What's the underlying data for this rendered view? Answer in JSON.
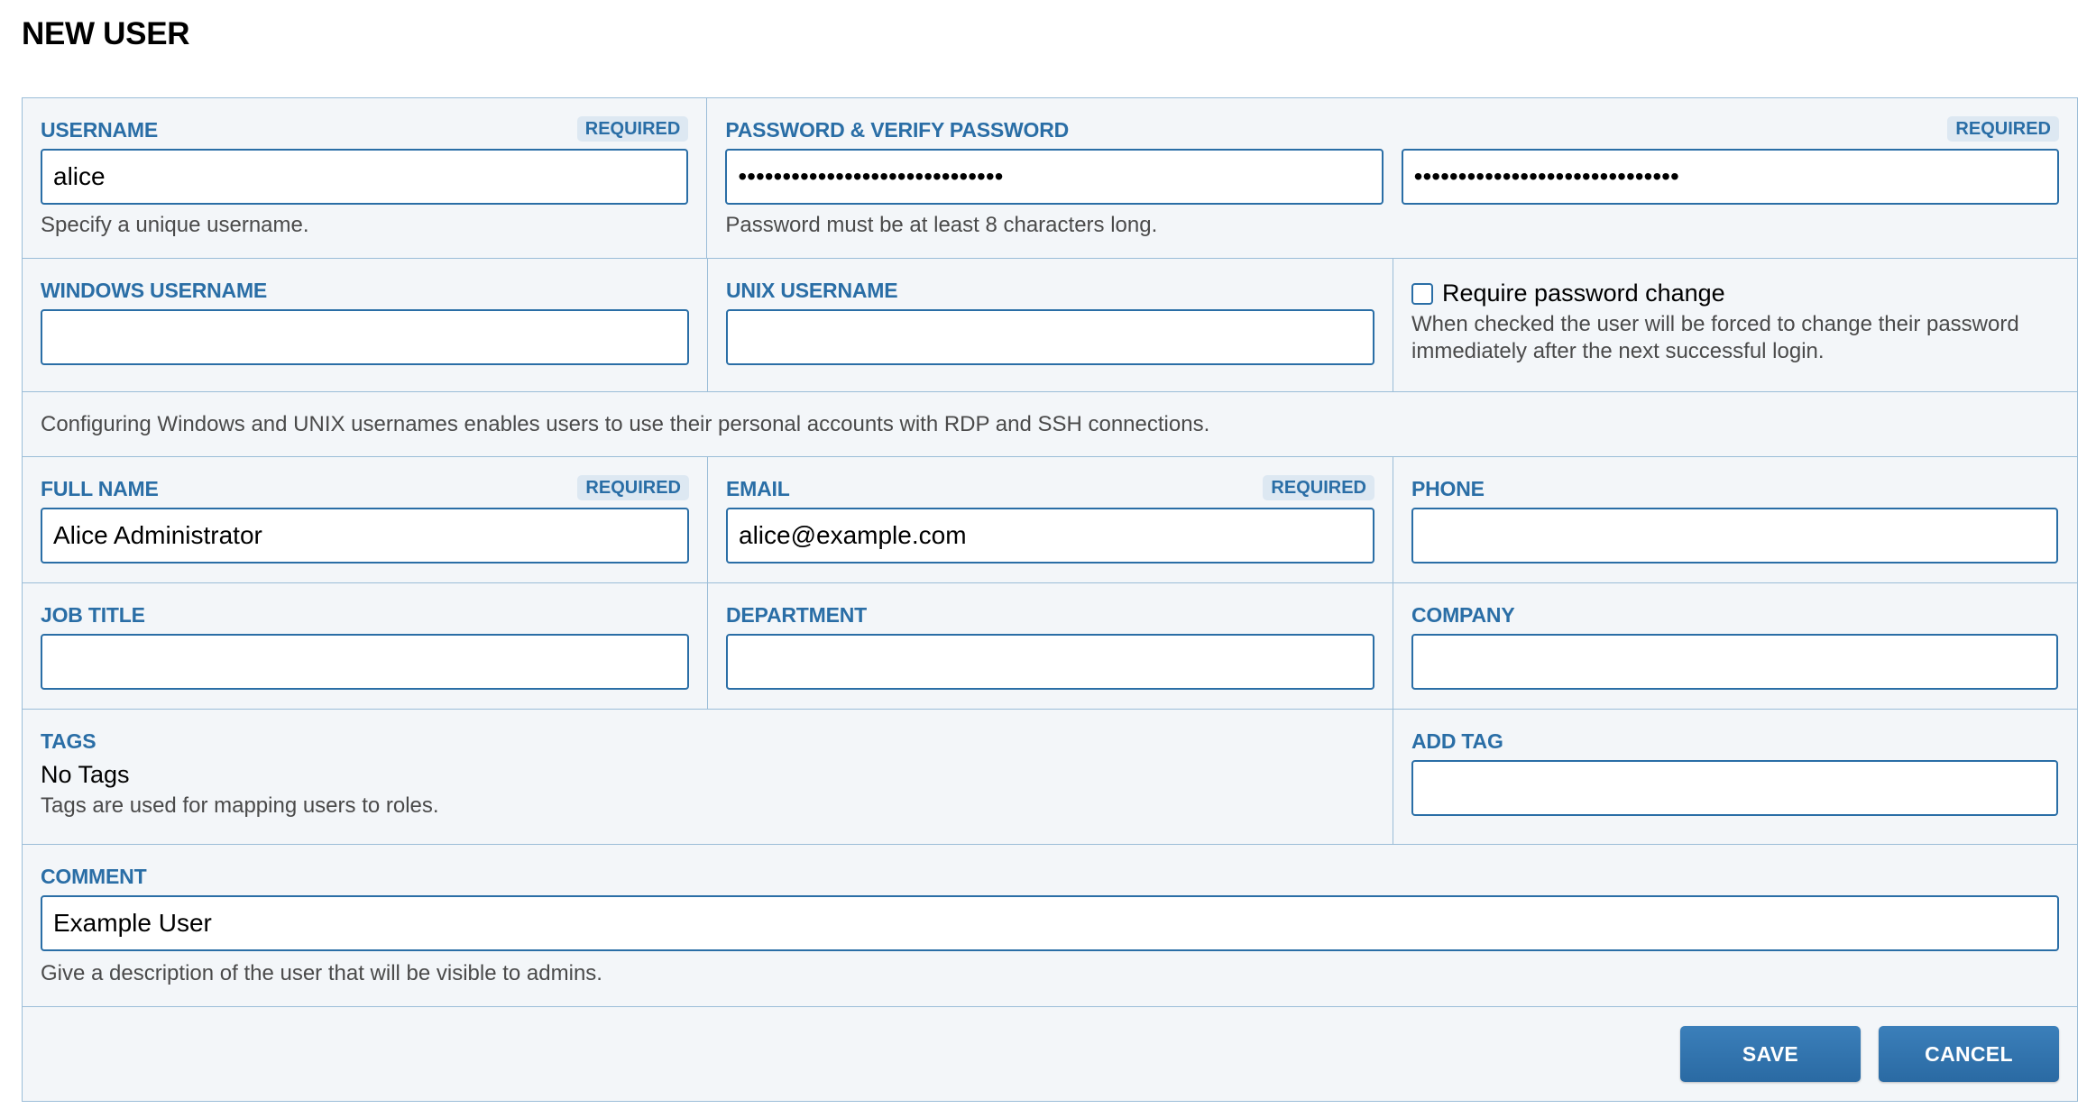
{
  "page": {
    "title": "NEW USER"
  },
  "badges": {
    "required": "REQUIRED"
  },
  "username": {
    "label": "USERNAME",
    "value": "alice",
    "help": "Specify a unique username."
  },
  "password": {
    "label": "PASSWORD & VERIFY PASSWORD",
    "masked_value": "••••••••••••••••••••••••••••••",
    "masked_verify": "••••••••••••••••••••••••••••••",
    "help": "Password must be at least 8 characters long."
  },
  "windows_username": {
    "label": "WINDOWS USERNAME",
    "value": ""
  },
  "unix_username": {
    "label": "UNIX USERNAME",
    "value": ""
  },
  "require_password_change": {
    "label": "Require password change",
    "checked": false,
    "help": "When checked the user will be forced to change their password immediately after the next successful login."
  },
  "usernames_note": "Configuring Windows and UNIX usernames enables users to use their personal accounts with RDP and SSH connections.",
  "full_name": {
    "label": "FULL NAME",
    "value": "Alice Administrator"
  },
  "email": {
    "label": "EMAIL",
    "value": "alice@example.com"
  },
  "phone": {
    "label": "PHONE",
    "value": ""
  },
  "job_title": {
    "label": "JOB TITLE",
    "value": ""
  },
  "department": {
    "label": "DEPARTMENT",
    "value": ""
  },
  "company": {
    "label": "COMPANY",
    "value": ""
  },
  "tags": {
    "label": "TAGS",
    "value": "No Tags",
    "help": "Tags are used for mapping users to roles."
  },
  "add_tag": {
    "label": "ADD TAG",
    "value": ""
  },
  "comment": {
    "label": "COMMENT",
    "value": "Example User",
    "help": "Give a description of the user that will be visible to admins."
  },
  "actions": {
    "save_label": "SAVE",
    "cancel_label": "CANCEL"
  }
}
